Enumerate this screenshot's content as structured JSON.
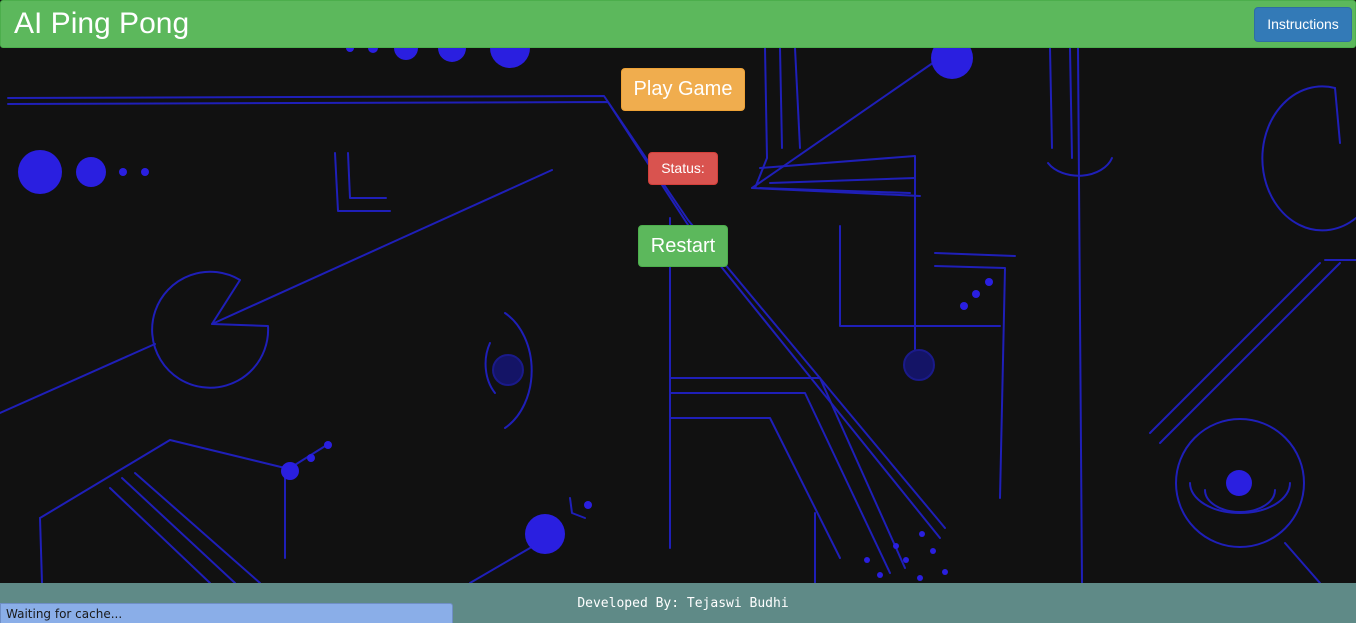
{
  "navbar": {
    "brand": "AI Ping Pong",
    "instructions_label": "Instructions",
    "color": "#5cb85c"
  },
  "controls": {
    "play_label": "Play Game",
    "status_label": "Status:",
    "restart_label": "Restart"
  },
  "footer": {
    "text": "Developed By: Tejaswi Budhi"
  },
  "browser_status": {
    "text": "Waiting for cache..."
  },
  "colors": {
    "background": "#111111",
    "circuit_line": "#1f1fb8",
    "circuit_dot": "#2a1fe0",
    "play": "#f0ad4e",
    "status": "#d9534f",
    "restart": "#5cb85c",
    "footer": "#5f8a87",
    "instructions": "#337ab7"
  }
}
